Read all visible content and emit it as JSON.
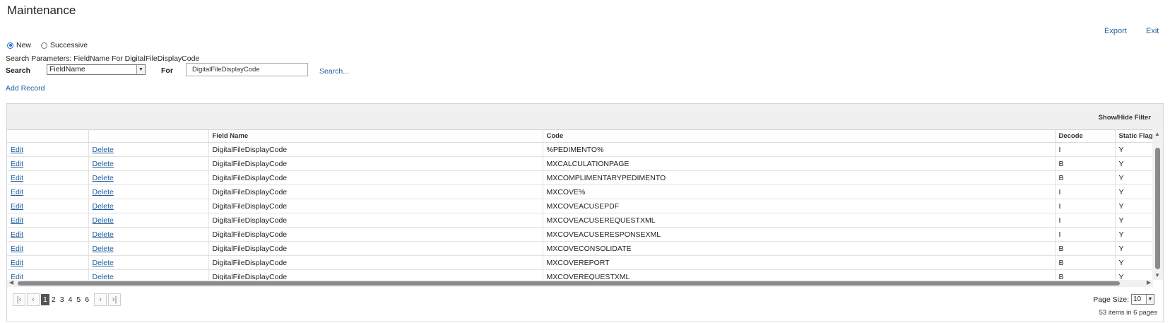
{
  "page": {
    "title": "Maintenance"
  },
  "top_links": {
    "export": "Export",
    "exit": "Exit"
  },
  "mode": {
    "new_label": "New",
    "successive_label": "Successive",
    "selected": "New"
  },
  "search": {
    "params_text": "Search Parameters: FieldName For DigitalFileDisplayCode",
    "search_label": "Search",
    "field_value": "FieldName",
    "for_label": "For",
    "for_value": "DigitalFileDisplayCode",
    "search_link": "Search..."
  },
  "add_record": "Add Record",
  "grid": {
    "show_hide_filter": "Show/Hide Filter",
    "columns": [
      "",
      "",
      "Field Name",
      "Code",
      "Decode",
      "Static Flag"
    ],
    "rows": [
      {
        "edit": "Edit",
        "delete": "Delete",
        "field": "DigitalFileDisplayCode",
        "code": "%PEDIMENTO%",
        "decode": "I",
        "flag": "Y"
      },
      {
        "edit": "Edit",
        "delete": "Delete",
        "field": "DigitalFileDisplayCode",
        "code": "MXCALCULATIONPAGE",
        "decode": "B",
        "flag": "Y"
      },
      {
        "edit": "Edit",
        "delete": "Delete",
        "field": "DigitalFileDisplayCode",
        "code": "MXCOMPLIMENTARYPEDIMENTO",
        "decode": "B",
        "flag": "Y"
      },
      {
        "edit": "Edit",
        "delete": "Delete",
        "field": "DigitalFileDisplayCode",
        "code": "MXCOVE%",
        "decode": "I",
        "flag": "Y"
      },
      {
        "edit": "Edit",
        "delete": "Delete",
        "field": "DigitalFileDisplayCode",
        "code": "MXCOVEACUSEPDF",
        "decode": "I",
        "flag": "Y"
      },
      {
        "edit": "Edit",
        "delete": "Delete",
        "field": "DigitalFileDisplayCode",
        "code": "MXCOVEACUSEREQUESTXML",
        "decode": "I",
        "flag": "Y"
      },
      {
        "edit": "Edit",
        "delete": "Delete",
        "field": "DigitalFileDisplayCode",
        "code": "MXCOVEACUSERESPONSEXML",
        "decode": "I",
        "flag": "Y"
      },
      {
        "edit": "Edit",
        "delete": "Delete",
        "field": "DigitalFileDisplayCode",
        "code": "MXCOVECONSOLIDATE",
        "decode": "B",
        "flag": "Y"
      },
      {
        "edit": "Edit",
        "delete": "Delete",
        "field": "DigitalFileDisplayCode",
        "code": "MXCOVEREPORT",
        "decode": "B",
        "flag": "Y"
      },
      {
        "edit": "Edit",
        "delete": "Delete",
        "field": "DigitalFileDisplayCode",
        "code": "MXCOVEREQUESTXML",
        "decode": "B",
        "flag": "Y"
      }
    ]
  },
  "pager": {
    "pages": [
      "1",
      "2",
      "3",
      "4",
      "5",
      "6"
    ],
    "current": "1",
    "page_size_label": "Page Size:",
    "page_size": "10",
    "summary": "53 items in 6 pages"
  }
}
